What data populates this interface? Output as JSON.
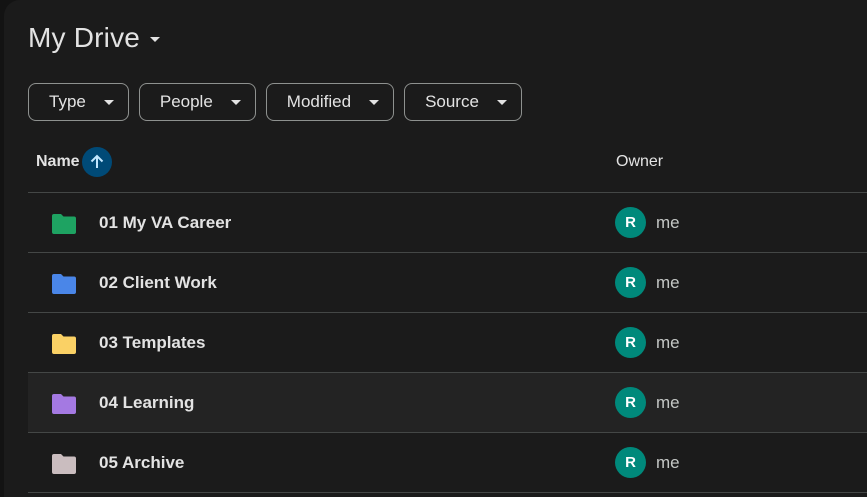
{
  "header": {
    "title": "My Drive"
  },
  "filters": [
    {
      "label": "Type"
    },
    {
      "label": "People"
    },
    {
      "label": "Modified"
    },
    {
      "label": "Source"
    }
  ],
  "table": {
    "columns": {
      "name": "Name",
      "owner": "Owner"
    },
    "sort": "ascending",
    "rows": [
      {
        "name": "01 My VA Career",
        "owner": "me",
        "avatar": "R",
        "folder_color": "#1ea362",
        "highlighted": false
      },
      {
        "name": "02 Client Work",
        "owner": "me",
        "avatar": "R",
        "folder_color": "#4a86e8",
        "highlighted": false
      },
      {
        "name": "03 Templates",
        "owner": "me",
        "avatar": "R",
        "folder_color": "#fad165",
        "highlighted": false
      },
      {
        "name": "04 Learning",
        "owner": "me",
        "avatar": "R",
        "folder_color": "#a479e2",
        "highlighted": true
      },
      {
        "name": "05 Archive",
        "owner": "me",
        "avatar": "R",
        "folder_color": "#cabdbf",
        "highlighted": false
      }
    ]
  },
  "colors": {
    "background": "#131313",
    "panel": "#1b1b1b",
    "sort_accent": "#004a77",
    "avatar": "#00897b"
  }
}
